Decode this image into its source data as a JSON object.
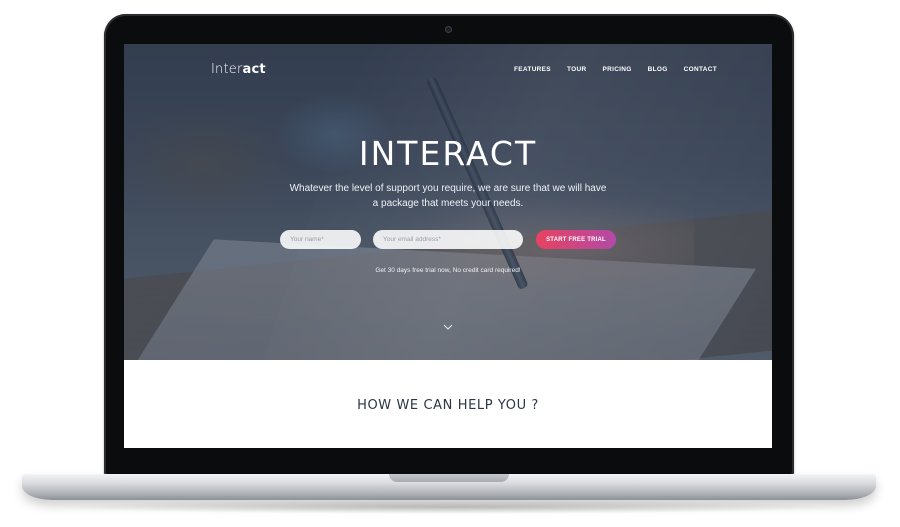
{
  "brand": {
    "logo_light": "Inter",
    "logo_bold": "act",
    "accent_gradient": [
      "#e8425f",
      "#b34aa8"
    ]
  },
  "nav": {
    "items": [
      {
        "label": "FEATURES"
      },
      {
        "label": "TOUR"
      },
      {
        "label": "PRICING"
      },
      {
        "label": "BLOG"
      },
      {
        "label": "CONTACT"
      }
    ]
  },
  "hero": {
    "title": "INTERACT",
    "subtitle": "Whatever the level of support you require, we are sure that we will have a package that meets your needs.",
    "name_placeholder": "Your name*",
    "email_placeholder": "Your email address*",
    "cta_label": "START FREE TRIAL",
    "note": "Get 30 days free trial now, No credit card required!",
    "scroll_icon": "chevron-down-icon"
  },
  "section": {
    "title": "HOW WE CAN HELP YOU ?"
  }
}
